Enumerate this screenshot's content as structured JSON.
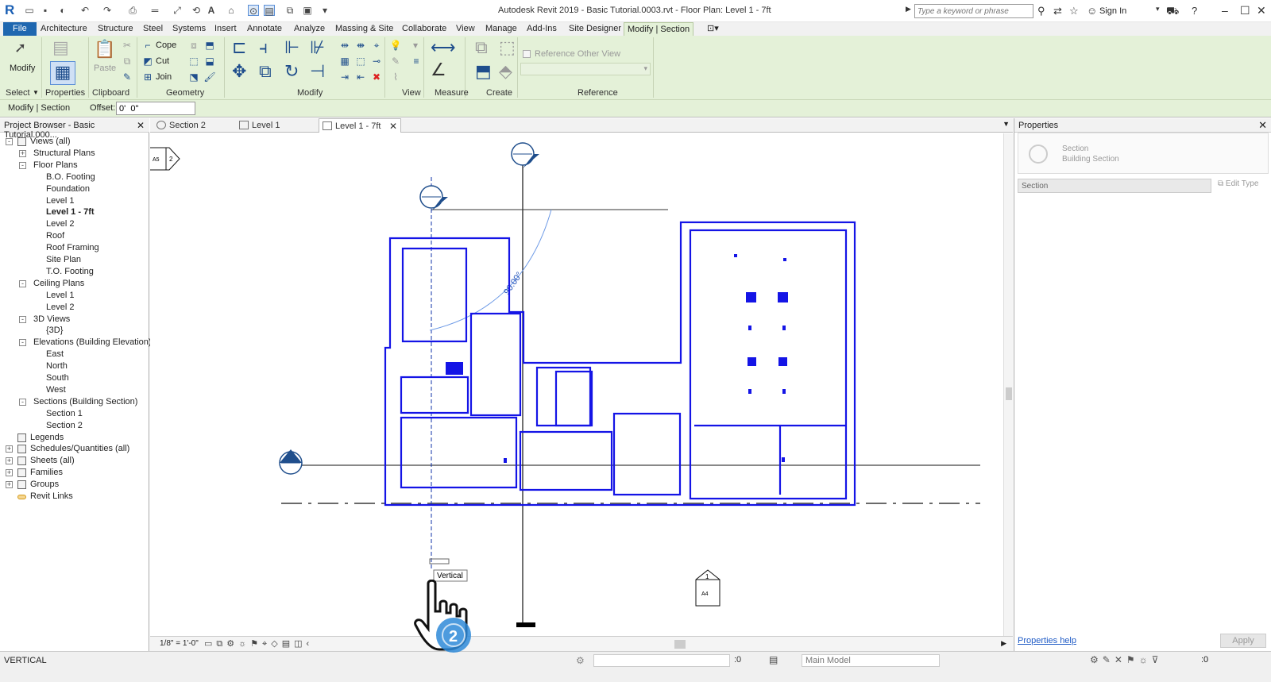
{
  "titlebar": {
    "title": "Autodesk Revit 2019 - Basic Tutorial.0003.rvt - Floor Plan: Level 1 - 7ft",
    "search_placeholder": "Type a keyword or phrase",
    "signin": "Sign In"
  },
  "ribbon_tabs": [
    "File",
    "Architecture",
    "Structure",
    "Steel",
    "Systems",
    "Insert",
    "Annotate",
    "Analyze",
    "Massing & Site",
    "Collaborate",
    "View",
    "Manage",
    "Add-Ins",
    "Site Designer",
    "Modify | Section"
  ],
  "ribbon": {
    "modify_label": "Modify",
    "paste_label": "Paste",
    "cope": "Cope",
    "cut": "Cut",
    "join": "Join",
    "reference_other_view": "Reference Other View",
    "panels": [
      "Select",
      "Properties",
      "Clipboard",
      "Geometry",
      "Modify",
      "View",
      "Measure",
      "Create",
      "Reference"
    ]
  },
  "optionsbar": {
    "context": "Modify | Section",
    "offset_label": "Offset:",
    "offset_value": "0'  0\""
  },
  "project_browser": {
    "title": "Project Browser - Basic Tutorial.000...",
    "nodes": [
      "Views (all)",
      "Structural Plans",
      "Floor Plans",
      "B.O. Footing",
      "Foundation",
      "Level 1",
      "Level 1 - 7ft",
      "Level 2",
      "Roof",
      "Roof Framing",
      "Site Plan",
      "T.O. Footing",
      "Ceiling Plans",
      "Level 1",
      "Level 2",
      "3D Views",
      "{3D}",
      "Elevations (Building Elevation)",
      "East",
      "North",
      "South",
      "West",
      "Sections (Building Section)",
      "Section 1",
      "Section 2",
      "Legends",
      "Schedules/Quantities (all)",
      "Sheets (all)",
      "Families",
      "Groups",
      "Revit Links"
    ]
  },
  "view_tabs": [
    "Section 2",
    "Level 1",
    "Level 1 - 7ft"
  ],
  "canvas": {
    "angle_label": "90.00°",
    "tooltip": "Vertical",
    "elev_tag_top": "A5",
    "elev_tag_top_num": "2",
    "section_tag_num": "1",
    "section_tag_sheet": "A4"
  },
  "viewcontrol": {
    "scale": "1/8\" = 1'-0\""
  },
  "properties": {
    "title": "Properties",
    "family": "Section",
    "type": "Building Section",
    "instance": "Section",
    "edit_type": "Edit Type",
    "help": "Properties help",
    "apply": "Apply"
  },
  "statusbar": {
    "text": "VERTICAL",
    "workset": "",
    "zero": ":0",
    "model": "Main Model",
    "filter": ":0"
  },
  "colors": {
    "ribbon": "#e4f1d8",
    "file_tab": "#1f67b0",
    "model_lines": "#1414e6"
  },
  "icons": [
    "revit-logo-icon",
    "open-icon",
    "save-icon",
    "undo-icon",
    "redo-icon",
    "print-icon",
    "measure-icon",
    "text-icon",
    "3d-icon",
    "section-icon",
    "binoculars-icon",
    "star-icon",
    "user-icon",
    "cart-icon",
    "help-icon",
    "minimize-icon",
    "maximize-icon",
    "close-icon"
  ]
}
